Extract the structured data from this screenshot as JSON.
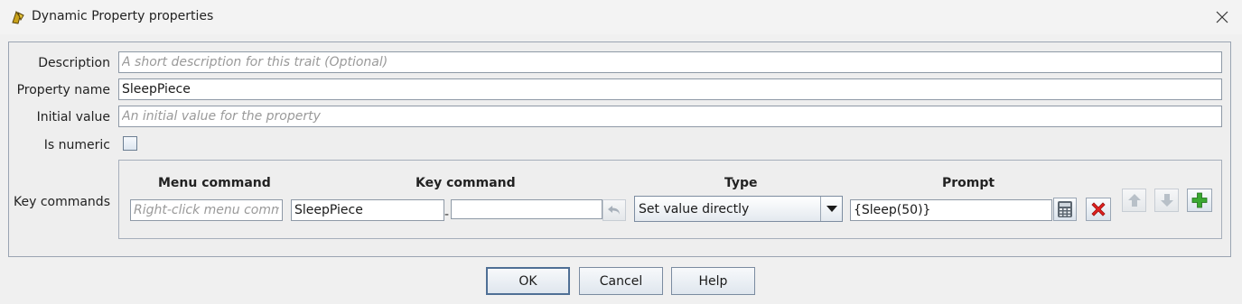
{
  "window": {
    "title": "Dynamic Property properties"
  },
  "form": {
    "description": {
      "label": "Description",
      "value": "",
      "placeholder": "A short description for this trait (Optional)"
    },
    "property_name": {
      "label": "Property name",
      "value": "SleepPiece"
    },
    "initial_value": {
      "label": "Initial value",
      "value": "",
      "placeholder": "An initial value for the property"
    },
    "is_numeric": {
      "label": "Is numeric",
      "checked": false
    },
    "key_commands": {
      "label": "Key commands",
      "columns": {
        "menu": "Menu command",
        "key": "Key command",
        "type": "Type",
        "prompt": "Prompt"
      },
      "row": {
        "menu_value": "",
        "menu_placeholder": "Right-click menu command",
        "key_value": "SleepPiece",
        "key_value_2": "",
        "type_value": "Set value directly",
        "prompt_value": "{Sleep(50)}"
      }
    }
  },
  "buttons": {
    "ok": "OK",
    "cancel": "Cancel",
    "help": "Help"
  },
  "colors": {
    "panel_border": "#9aa4b2",
    "delete_red": "#e02020",
    "add_green": "#3aa832"
  }
}
